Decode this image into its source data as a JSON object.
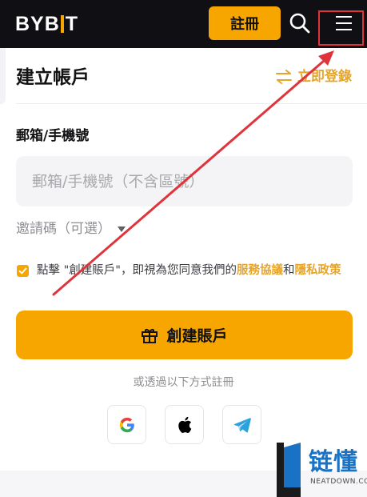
{
  "header": {
    "logo_left": "BYB",
    "logo_right": "T",
    "register_label": "註冊"
  },
  "page": {
    "title": "建立帳戶",
    "login_link": "立即登錄"
  },
  "form": {
    "field_label": "郵箱/手機號",
    "input_placeholder": "郵箱/手機號（不含區號）",
    "input_value": "",
    "referral_label": "邀請碼（可選）",
    "agree_checked": true,
    "agree_prefix": "點擊 \"創建賬戶\"，即視為您同意我們的",
    "agree_terms": "服務協議",
    "agree_and": "和",
    "agree_privacy": "隱私政策",
    "create_label": "創建賬戶"
  },
  "social": {
    "alt_text": "或透過以下方式註冊",
    "providers": [
      "google-icon",
      "apple-icon",
      "telegram-icon"
    ]
  },
  "watermark": {
    "title": "链懂",
    "url": "NEATDOWN.COM"
  },
  "colors": {
    "brand": "#f7a600",
    "link": "#e6a52a",
    "annotation": "#e0343c",
    "watermark": "#1a72c4"
  }
}
